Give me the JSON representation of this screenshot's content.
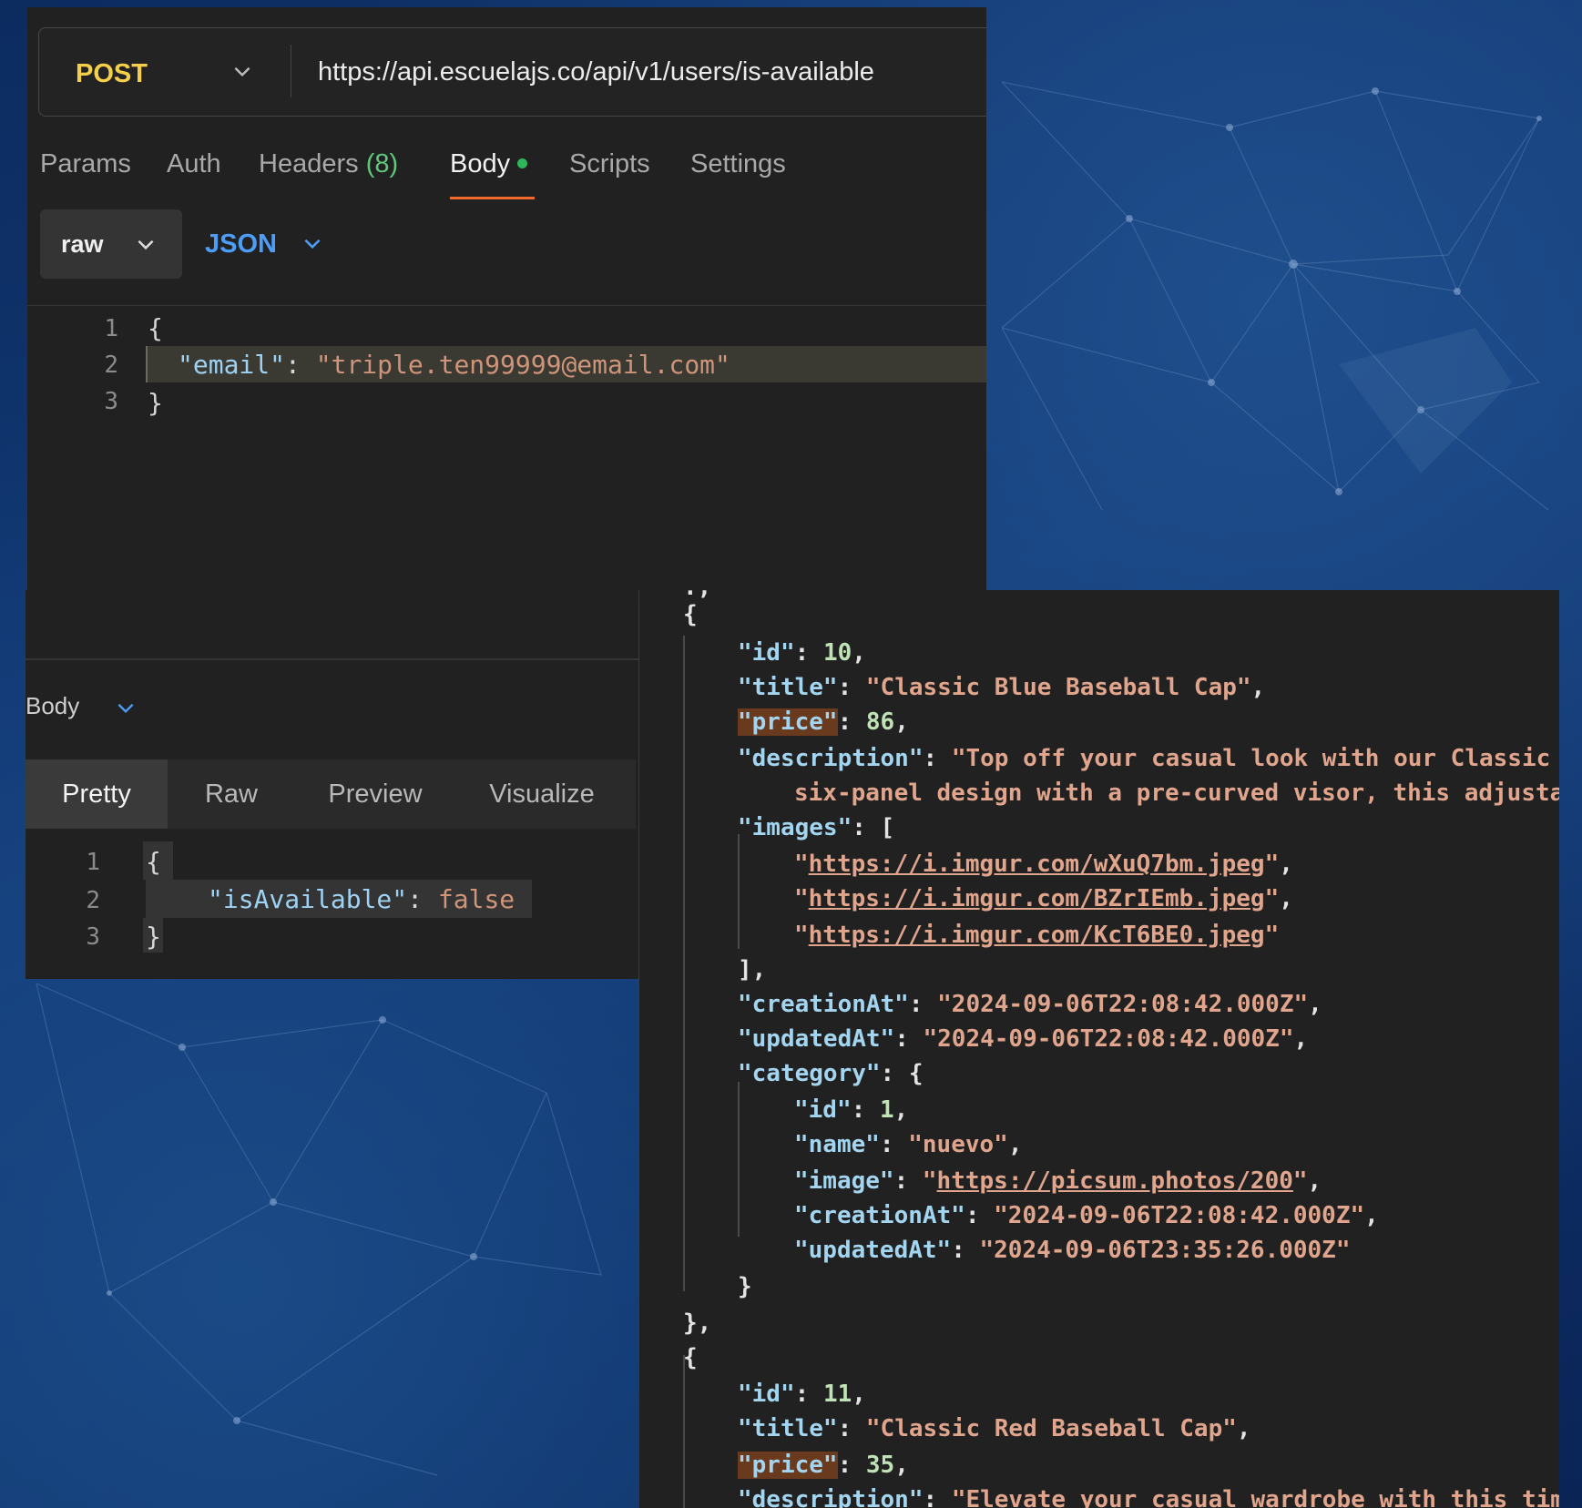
{
  "request": {
    "method": "POST",
    "url": "https://api.escuelajs.co/api/v1/users/is-available",
    "tabs": {
      "params": "Params",
      "auth": "Auth",
      "headers": "Headers",
      "headers_count": "(8)",
      "body": "Body",
      "scripts": "Scripts",
      "settings": "Settings"
    },
    "body_mode": "raw",
    "body_format": "JSON",
    "line_numbers": [
      "1",
      "2",
      "3"
    ],
    "code": {
      "open": "{",
      "key": "\"email\"",
      "colon": ": ",
      "value": "\"triple.ten99999@email.com\"",
      "close": "}"
    }
  },
  "response": {
    "section_label": "Body",
    "view_tabs": [
      "Pretty",
      "Raw",
      "Preview",
      "Visualize"
    ],
    "selected_view": "Pretty",
    "line_numbers": [
      "1",
      "2",
      "3"
    ],
    "code": {
      "open": "{",
      "key": "\"isAvailable\"",
      "colon": ": ",
      "value": "false",
      "close": "}"
    }
  },
  "products_json": {
    "item1": {
      "id_key": "\"id\"",
      "id_val": "10",
      "title_key": "\"title\"",
      "title_val": "\"Classic Blue Baseball Cap\"",
      "price_key": "\"price\"",
      "price_val": "86",
      "description_key": "\"description\"",
      "description_val_1": "\"Top off your casual look with our Classic B",
      "description_val_2": "six-panel design with a pre-curved visor, this adjustab",
      "images_key": "\"images\"",
      "images": [
        "https://i.imgur.com/wXuQ7bm.jpeg",
        "https://i.imgur.com/BZrIEmb.jpeg",
        "https://i.imgur.com/KcT6BE0.jpeg"
      ],
      "creationAt_key": "\"creationAt\"",
      "creationAt_val": "\"2024-09-06T22:08:42.000Z\"",
      "updatedAt_key": "\"updatedAt\"",
      "updatedAt_val": "\"2024-09-06T22:08:42.000Z\"",
      "category_key": "\"category\"",
      "category": {
        "id_key": "\"id\"",
        "id_val": "1",
        "name_key": "\"name\"",
        "name_val": "\"nuevo\"",
        "image_key": "\"image\"",
        "image_val": "https://picsum.photos/200",
        "creationAt_key": "\"creationAt\"",
        "creationAt_val": "\"2024-09-06T22:08:42.000Z\"",
        "updatedAt_key": "\"updatedAt\"",
        "updatedAt_val": "\"2024-09-06T23:35:26.000Z\""
      }
    },
    "item2": {
      "id_key": "\"id\"",
      "id_val": "11",
      "title_key": "\"title\"",
      "title_val": "\"Classic Red Baseball Cap\"",
      "price_key": "\"price\"",
      "price_val": "35",
      "description_key": "\"description\"",
      "description_val": "\"Elevate your casual wardrobe with this tim"
    }
  },
  "colors": {
    "method": "#f5cf4a",
    "active_tab_underline": "#f26a2b",
    "body_dot": "#2fb65b",
    "json_format": "#4d9cf5"
  },
  "icons": [
    "chevron-down-icon",
    "status-dot-icon"
  ]
}
